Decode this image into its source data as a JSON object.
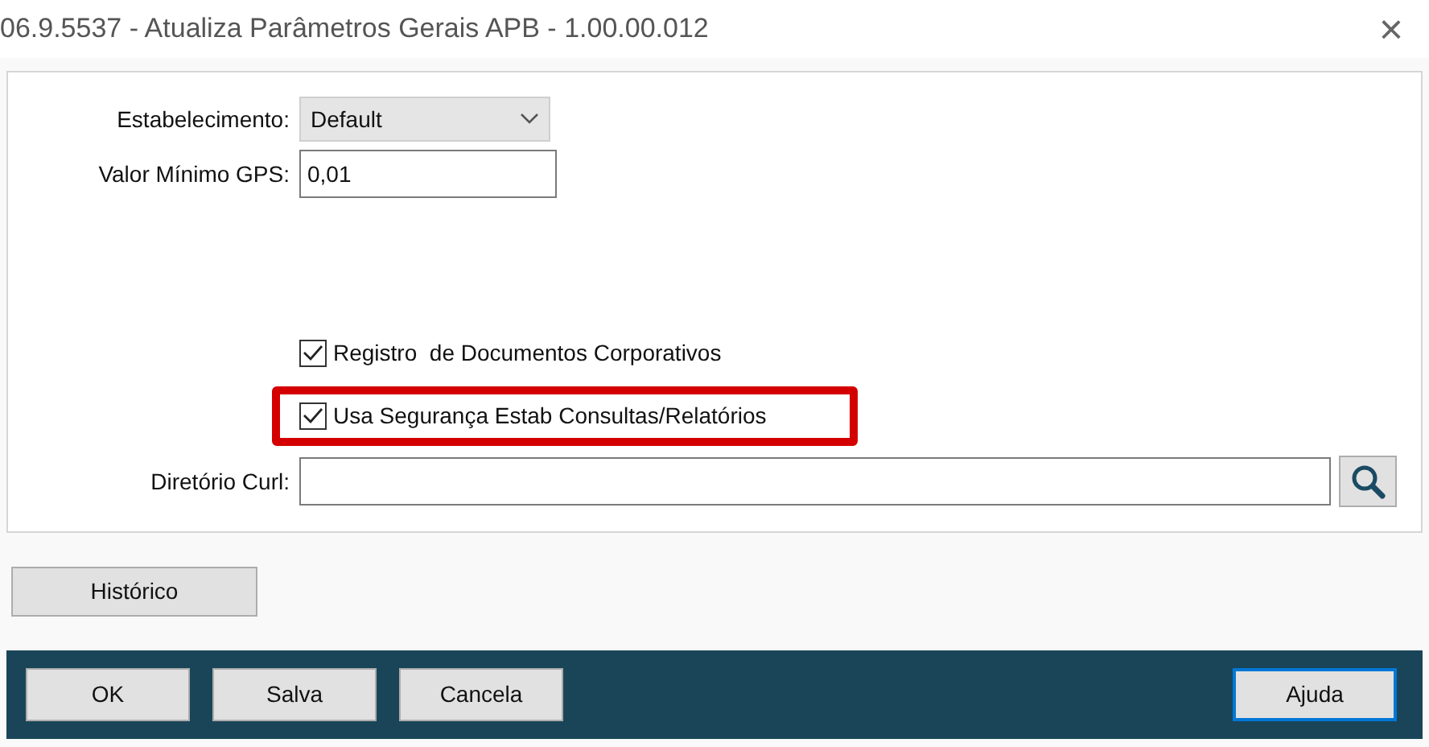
{
  "window": {
    "title": "06.9.5537 - Atualiza Parâmetros Gerais APB - 1.00.00.012",
    "close": "×"
  },
  "fields": [
    {
      "kind": "combo",
      "label": "Estabelecimento:",
      "value": "Default"
    },
    {
      "kind": "text",
      "label": "Valor Mínimo GPS:",
      "value": "0,01"
    }
  ],
  "checkboxes": [
    {
      "label": "Registro  de Documentos Corporativos",
      "checked": true,
      "highlighted": false
    },
    {
      "label": "Usa Segurança Estab Consultas/Relatórios",
      "checked": true,
      "highlighted": true
    }
  ],
  "directory": {
    "label": "Diretório Curl:"
  },
  "history_button": "Histórico",
  "footer_buttons": [
    {
      "label": "OK",
      "focused": false
    },
    {
      "label": "Salva",
      "focused": false
    },
    {
      "label": "Cancela",
      "focused": false
    },
    {
      "label": "Ajuda",
      "focused": true
    }
  ]
}
